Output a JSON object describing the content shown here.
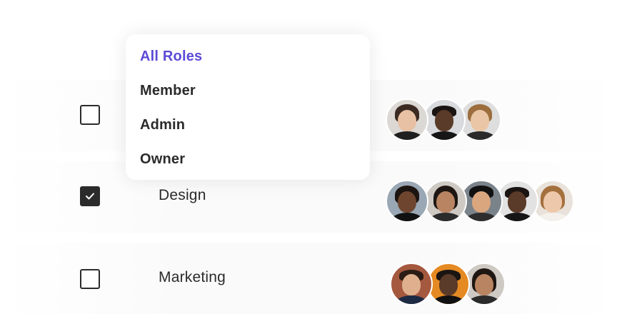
{
  "dropdown": {
    "items": [
      {
        "label": "All Roles",
        "active": true
      },
      {
        "label": "Member",
        "active": false
      },
      {
        "label": "Admin",
        "active": false
      },
      {
        "label": "Owner",
        "active": false
      }
    ]
  },
  "teams": [
    {
      "label": "",
      "checked": false,
      "avatar_count": 3
    },
    {
      "label": "Design",
      "checked": true,
      "avatar_count": 5
    },
    {
      "label": "Marketing",
      "checked": false,
      "avatar_count": 3
    }
  ],
  "colors": {
    "accent": "#5b4bd6",
    "text": "#2b2b2b",
    "checkbox_checked": "#2b2b2b"
  },
  "icons": {
    "check": "check-icon"
  }
}
